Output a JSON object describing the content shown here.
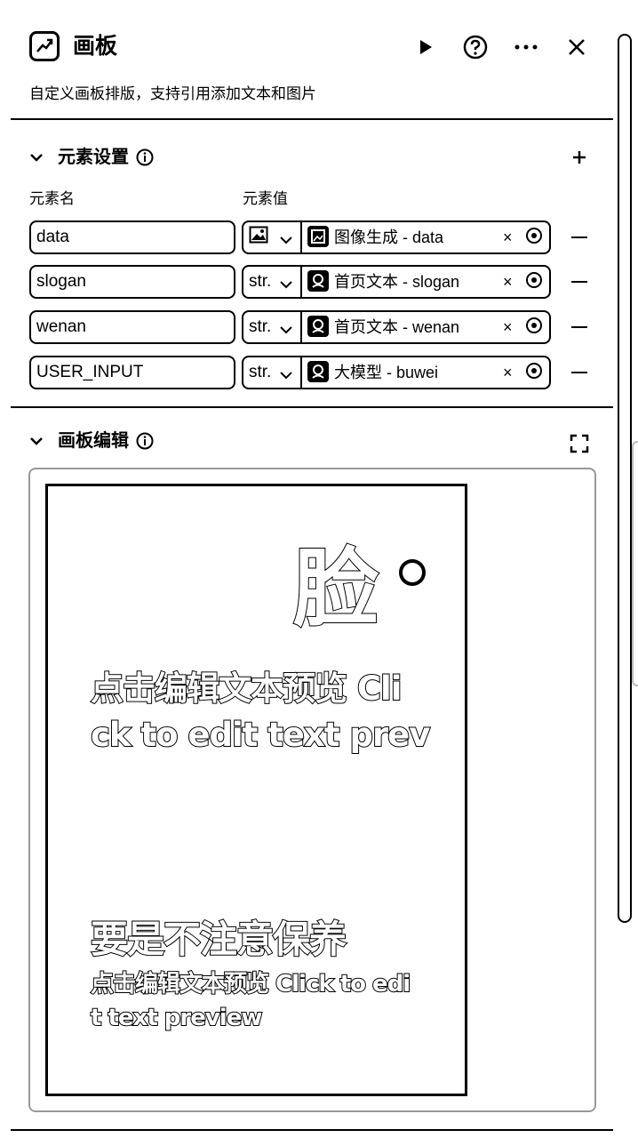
{
  "header": {
    "title": "画板",
    "subtitle": "自定义画板排版，支持引用添加文本和图片",
    "icons": [
      "run-icon",
      "help-icon",
      "more-icon",
      "close-icon"
    ]
  },
  "elements_section": {
    "title": "元素设置",
    "col_name_label": "元素名",
    "col_value_label": "元素值",
    "rows": [
      {
        "name": "data",
        "type": "image",
        "ref": "图像生成 - data"
      },
      {
        "name": "slogan",
        "type": "str.",
        "ref": "首页文本 - slogan"
      },
      {
        "name": "wenan",
        "type": "str.",
        "ref": "首页文本 - wenan"
      },
      {
        "name": "USER_INPUT",
        "type": "str.",
        "ref": "大模型 - buwei"
      }
    ],
    "clear_symbol": "×"
  },
  "canvas_section": {
    "title": "画板编辑",
    "canvas": {
      "big_char": "脸",
      "text1_line1": "点击编辑文本预览 Cli",
      "text1_line2": "ck to edit text prev",
      "text2_line1": "要是不注意保养",
      "text3_line1": "点击编辑文本预览 Click to edi",
      "text3_line2": "t text preview"
    }
  }
}
